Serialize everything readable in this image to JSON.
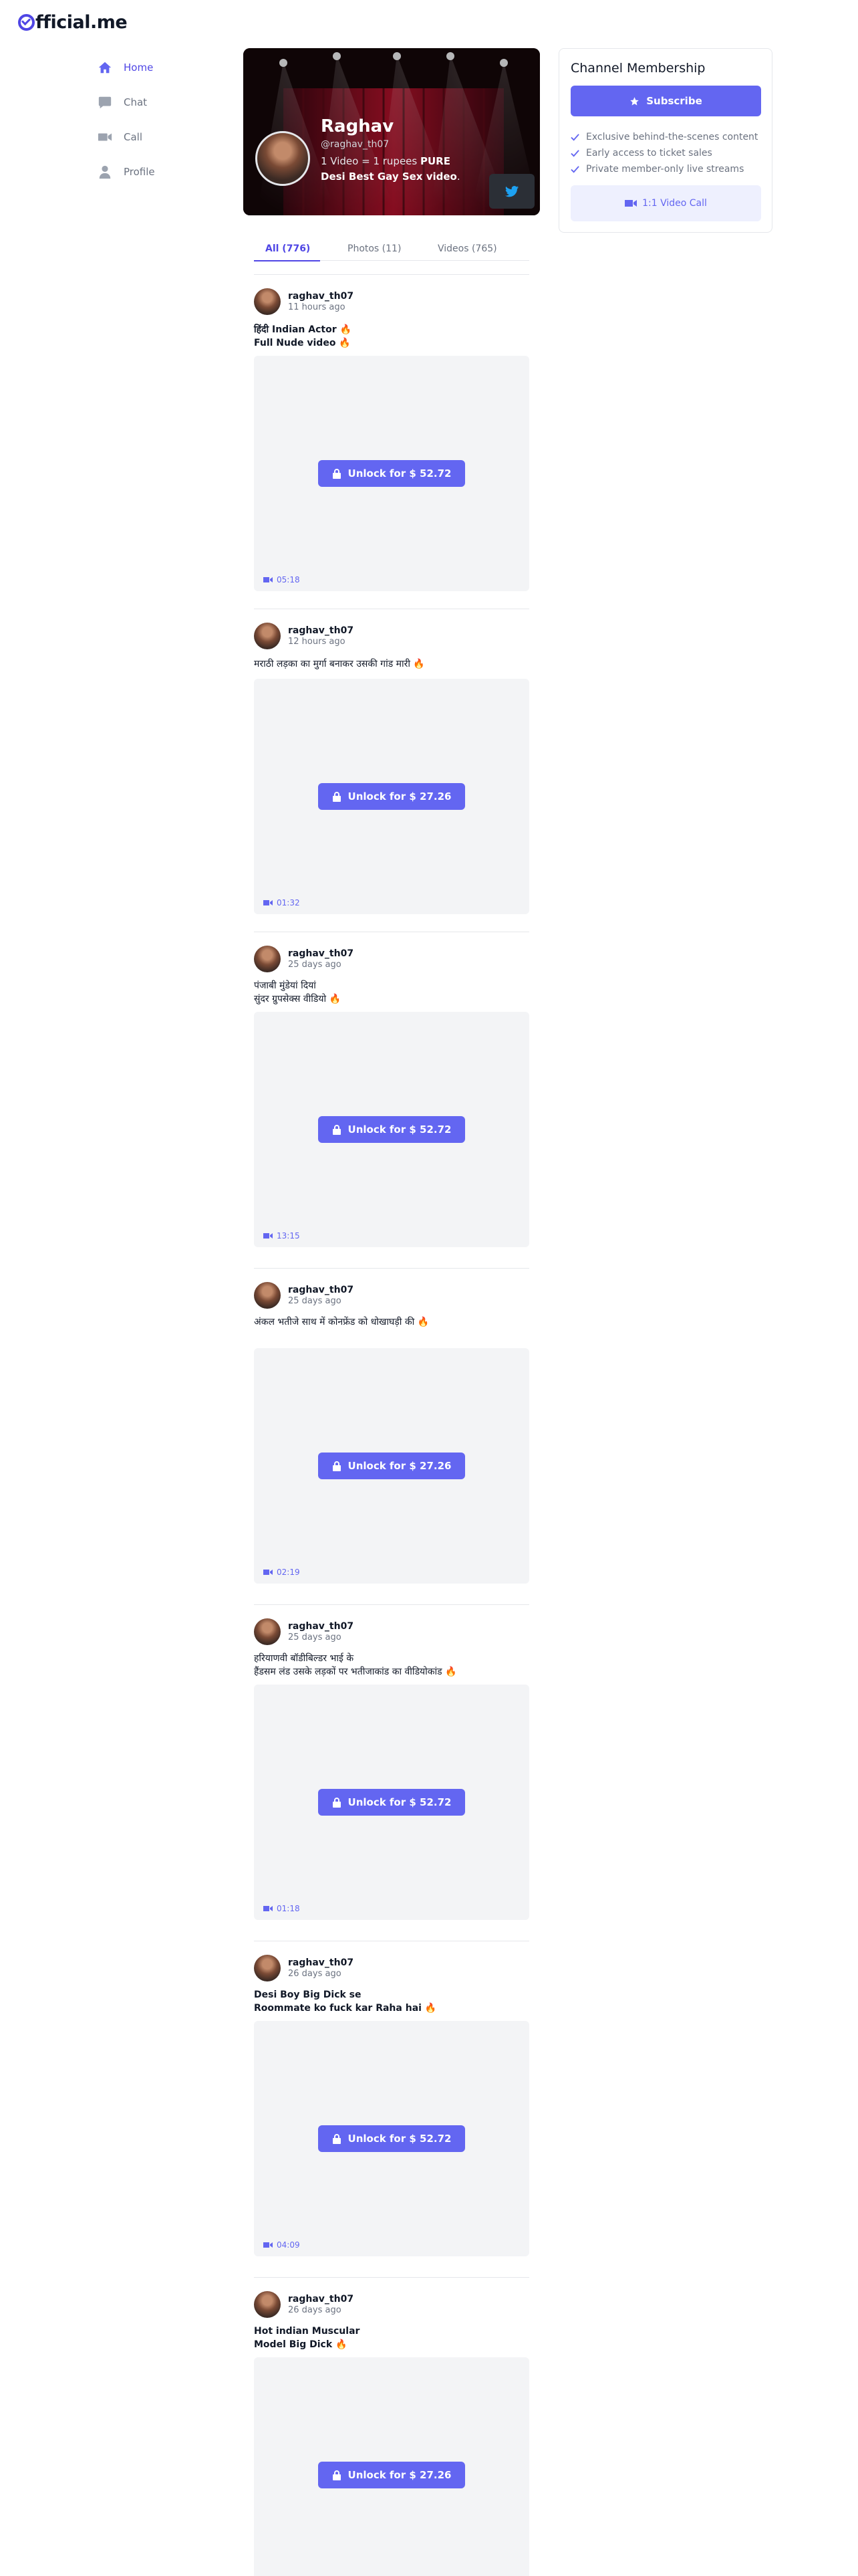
{
  "brand": {
    "logo_text": "fficial.me",
    "accent": "#6366f1"
  },
  "nav": {
    "items": [
      {
        "label": "Home",
        "icon": "home-icon",
        "active": true
      },
      {
        "label": "Chat",
        "icon": "chat-icon",
        "active": false
      },
      {
        "label": "Call",
        "icon": "video-camera-icon",
        "active": false
      },
      {
        "label": "Profile",
        "icon": "user-icon",
        "active": false
      }
    ]
  },
  "profile": {
    "name": "Raghav",
    "handle": "@raghav_th07",
    "bio_prefix": "1 Video = 1 rupees ",
    "bio_bold": "PURE Desi Best Gay Sex video",
    "bio_suffix": ".",
    "social_icon": "twitter-icon"
  },
  "tabs": [
    {
      "label": "All (776)",
      "active": true
    },
    {
      "label": "Photos (11)",
      "active": false
    },
    {
      "label": "Videos (765)",
      "active": false
    }
  ],
  "posts": [
    {
      "user": "raghav_th07",
      "time": "11 hours ago",
      "caption": "हिंदी Indian Actor 🔥\nFull Nude video 🔥",
      "bold": true,
      "unlock": "Unlock for $ 52.72",
      "duration": "05:18"
    },
    {
      "user": "raghav_th07",
      "time": "12 hours ago",
      "caption": "मराठी लड़का का मुर्गा बनाकर उसकी गांड मारी 🔥",
      "bold": false,
      "unlock": "Unlock for $ 27.26",
      "duration": "01:32"
    },
    {
      "user": "raghav_th07",
      "time": "25 days ago",
      "caption": "पंजाबी मुंडेयां दियां\nसुंदर ग्रुपसेक्स वीडियो 🔥",
      "bold": false,
      "unlock": "Unlock for $ 52.72",
      "duration": "13:15"
    },
    {
      "user": "raghav_th07",
      "time": "25 days ago",
      "caption": "अंकल भतीजे साथ में कोनफ्रेंड को धोखाघड़ी की 🔥",
      "bold": false,
      "unlock": "Unlock for $ 27.26",
      "duration": "02:19"
    },
    {
      "user": "raghav_th07",
      "time": "25 days ago",
      "caption": "हरियाणवी बॉडीबिल्डर भाई के\nहैंडसम लंड उसके लड़कों पर भतीजाकांड का वीडियोकांड 🔥",
      "bold": false,
      "unlock": "Unlock for $ 52.72",
      "duration": "01:18"
    },
    {
      "user": "raghav_th07",
      "time": "26 days ago",
      "caption": "Desi Boy Big Dick se\nRoommate ko fuck kar Raha hai 🔥",
      "bold": true,
      "unlock": "Unlock for $ 52.72",
      "duration": "04:09"
    },
    {
      "user": "raghav_th07",
      "time": "26 days ago",
      "caption": "Hot indian Muscular\nModel Big Dick 🔥",
      "bold": true,
      "unlock": "Unlock for $ 27.26",
      "duration": ""
    }
  ],
  "membership": {
    "title": "Channel Membership",
    "subscribe_label": "Subscribe",
    "perks": [
      "Exclusive behind-the-scenes content",
      "Early access to ticket sales",
      "Private member-only live streams"
    ],
    "video_call_label": "1:1 Video Call"
  }
}
